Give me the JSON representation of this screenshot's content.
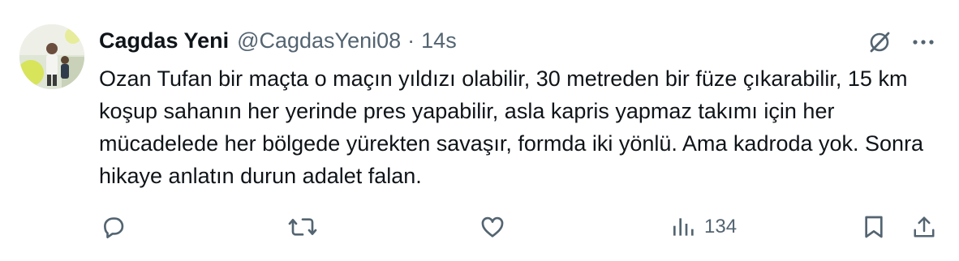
{
  "tweet": {
    "author": {
      "display_name": "Cagdas Yeni",
      "handle": "@CagdasYeni08"
    },
    "separator": "·",
    "time": "14s",
    "text": "Ozan Tufan bir maçta o maçın yıldızı olabilir, 30 metreden bir füze çıkarabilir, 15 km koşup sahanın her yerinde pres yapabilir, asla kapris yapmaz takımı için her mücadelede her bölgede yürekten savaşır, formda iki yönlü. Ama kadroda yok. Sonra hikaye anlatın durun adalet falan.",
    "stats": {
      "views": "134"
    }
  },
  "icons": {
    "grok": "grok-icon",
    "more": "more-icon",
    "reply": "reply-icon",
    "retweet": "retweet-icon",
    "like": "like-icon",
    "views": "views-icon",
    "bookmark": "bookmark-icon",
    "share": "share-icon"
  },
  "colors": {
    "text": "#0f1419",
    "secondary": "#536471",
    "background": "#ffffff"
  }
}
